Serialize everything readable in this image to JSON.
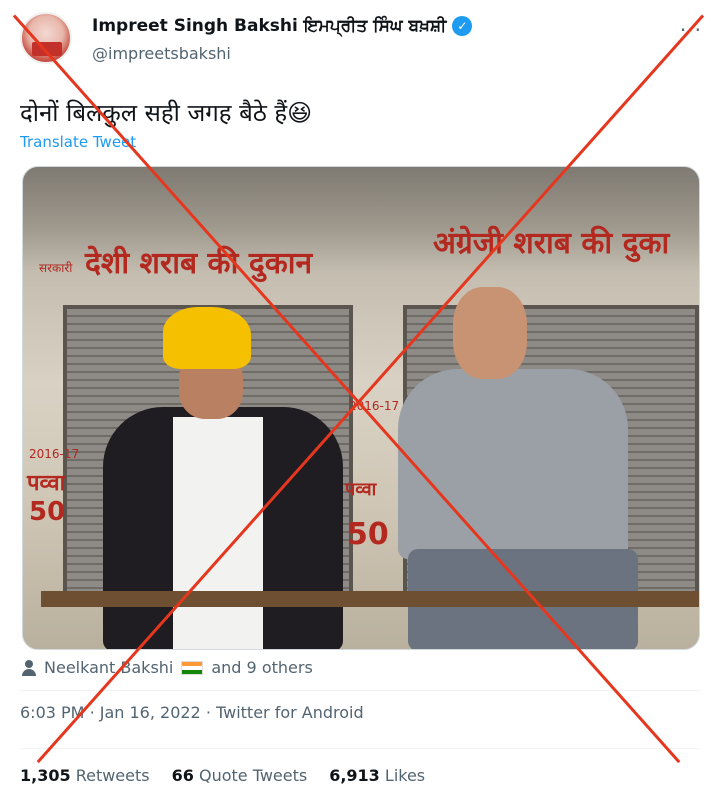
{
  "header": {
    "display_name": "Impreet Singh Bakshi ਇਮਪ੍ਰੀਤ ਸਿੰਘ ਬਖ਼ਸ਼ੀ",
    "handle": "@impreetsbakshi",
    "verified_icon": "verified-badge-icon",
    "more_icon": "more-icon",
    "more_label": "···"
  },
  "tweet": {
    "text": "दोनों बिलकुल सही जगह बैठे हैं😆",
    "translate_label": "Translate Tweet"
  },
  "media": {
    "sign_left": "देशी शराब की दुकान",
    "sign_left_prefix": "सरकारी",
    "sign_right": "अंग्रेजी शराब की दुका",
    "sign_side_left": "पव्वा",
    "sign_side_left_price": "50",
    "sign_side_left_year": "2016-17",
    "sign_side_mid": "पव्वा",
    "sign_side_mid_price": "50",
    "sign_side_mid_year": "2016-17"
  },
  "likers": {
    "icon": "person-icon",
    "name": "Neelkant Bakshi",
    "others": "and 9 others"
  },
  "meta": {
    "time": "6:03 PM",
    "date": "Jan 16, 2022",
    "source": "Twitter for Android"
  },
  "stats": {
    "retweets_count": "1,305",
    "retweets_label": "Retweets",
    "quotes_count": "66",
    "quotes_label": "Quote Tweets",
    "likes_count": "6,913",
    "likes_label": "Likes"
  },
  "colors": {
    "cross": "#e5371e",
    "link": "#1d9bf0",
    "secondary_text": "#536471"
  }
}
